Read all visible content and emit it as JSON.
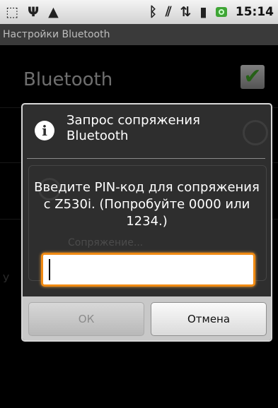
{
  "statusbar": {
    "icons": [
      "sim-card-icon",
      "usb-icon",
      "warning-icon",
      "bluetooth-icon",
      "vibrate-icon",
      "data-transfer-icon",
      "signal-icon",
      "battery-charging-icon"
    ],
    "time": "15:14"
  },
  "titlebar": {
    "title": "Настройки Bluetooth"
  },
  "background": {
    "bluetooth_label": "Bluetooth",
    "bluetooth_checked": true,
    "ghost_pairing_text": "Сопряжение...",
    "ghost_letter": "У"
  },
  "dialog": {
    "title": "Запрос сопряжения Bluetooth",
    "message": "Введите PIN-код для сопряжения с Z530i. (Попробуйте 0000 или 1234.)",
    "pin_value": "",
    "pin_placeholder": "",
    "ok_label": "ОК",
    "cancel_label": "Отмена"
  },
  "colors": {
    "input_focus": "#f08a12",
    "checkbox_check": "#45b02b"
  }
}
